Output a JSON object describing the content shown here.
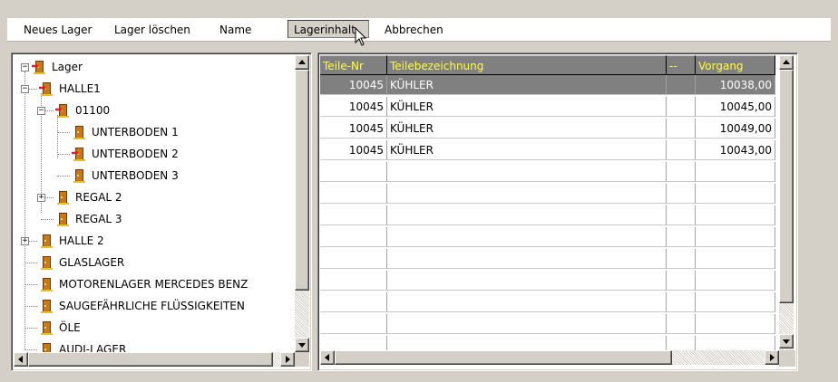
{
  "toolbar": {
    "new_storage": "Neues Lager",
    "delete_storage": "Lager löschen",
    "name": "Name",
    "storage_contents": "Lagerinhalt",
    "cancel": "Abbrechen"
  },
  "tree": {
    "items": [
      {
        "label": "Lager",
        "icon": "warehouse-arrow-icon",
        "expander": "minus"
      },
      {
        "label": "HALLE1",
        "icon": "warehouse-arrow-icon",
        "expander": "minus"
      },
      {
        "label": "01100",
        "icon": "warehouse-arrow-icon",
        "expander": "minus"
      },
      {
        "label": "UNTERBODEN 1",
        "icon": "storage-door-icon",
        "expander": ""
      },
      {
        "label": "UNTERBODEN 2",
        "icon": "warehouse-arrow-icon",
        "expander": ""
      },
      {
        "label": "UNTERBODEN 3",
        "icon": "storage-door-icon",
        "expander": ""
      },
      {
        "label": "REGAL 2",
        "icon": "storage-door-icon",
        "expander": "plus"
      },
      {
        "label": "REGAL 3",
        "icon": "storage-door-icon",
        "expander": ""
      },
      {
        "label": "HALLE 2",
        "icon": "storage-door-icon",
        "expander": "plus"
      },
      {
        "label": "GLASLAGER",
        "icon": "storage-door-icon",
        "expander": ""
      },
      {
        "label": "MOTORENLAGER MERCEDES BENZ",
        "icon": "storage-door-icon",
        "expander": ""
      },
      {
        "label": "SAUGEFÄHRLICHE FLÜSSIGKEITEN",
        "icon": "storage-door-icon",
        "expander": ""
      },
      {
        "label": "ÖLE",
        "icon": "storage-door-icon",
        "expander": ""
      },
      {
        "label": "AUDI-LAGER",
        "icon": "storage-door-icon",
        "expander": ""
      }
    ]
  },
  "grid": {
    "columns": [
      "Teile-Nr",
      "Teilebezeichnung",
      "--",
      "Vorgang"
    ],
    "rows": [
      {
        "teile_nr": "10045",
        "bezeichnung": "KÜHLER",
        "extra": "",
        "vorgang": "10038,00",
        "selected": true
      },
      {
        "teile_nr": "10045",
        "bezeichnung": "KÜHLER",
        "extra": "",
        "vorgang": "10045,00",
        "selected": false
      },
      {
        "teile_nr": "10045",
        "bezeichnung": "KÜHLER",
        "extra": "",
        "vorgang": "10049,00",
        "selected": false
      },
      {
        "teile_nr": "10045",
        "bezeichnung": "KÜHLER",
        "extra": "",
        "vorgang": "10043,00",
        "selected": false
      }
    ]
  },
  "colors": {
    "header_bg": "#808080",
    "header_text": "#ffff40",
    "selection": "#808080",
    "window": "#d4d0c8"
  }
}
